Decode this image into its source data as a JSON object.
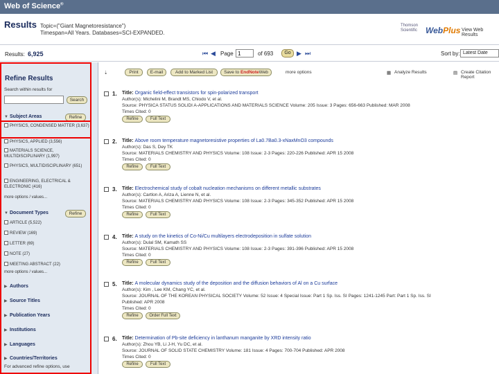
{
  "header": {
    "logo": "Web of Science",
    "logo_mark": "®"
  },
  "results": {
    "title": "Results",
    "topic": "Topic=(\"Giant Magnetoresistance\")",
    "timespan": "Timespan=All Years. Databases=SCI-EXPANDED.",
    "count_label": "Results:",
    "count": "6,925"
  },
  "brand": {
    "thomson": "Thomson",
    "scientific": "Scientific",
    "web": "Web",
    "plus": "Plus",
    "link": "View Web Results"
  },
  "pager": {
    "first": "⏮",
    "prev": "◀",
    "page_label": "Page",
    "page_value": "1",
    "of_label": "of 693",
    "go": "Go",
    "next": "▶",
    "last": "⏭"
  },
  "sort": {
    "label": "Sort by:",
    "value": "Latest Date"
  },
  "sidebar": {
    "title": "Refine Results",
    "search_within": "Search within results for",
    "search_button": "Search",
    "refine_button": "Refine",
    "subject": {
      "title": "Subject Areas",
      "items": [
        {
          "label": "PHYSICS, CONDENSED MATTER",
          "count": "(3,637)"
        },
        {
          "label": "PHYSICS, APPLIED",
          "count": "(3,556)"
        },
        {
          "label": "MATERIALS SCIENCE, MULTIDISCIPLINARY",
          "count": "(1,997)"
        },
        {
          "label": "PHYSICS, MULTIDISCIPLINARY",
          "count": "(651)"
        },
        {
          "label": "ENGINEERING, ELECTRICAL & ELECTRONIC",
          "count": "(416)"
        }
      ],
      "more": "more options / values..."
    },
    "doctypes": {
      "title": "Document Types",
      "items": [
        {
          "label": "ARTICLE",
          "count": "(5,522)"
        },
        {
          "label": "REVIEW",
          "count": "(169)"
        },
        {
          "label": "LETTER",
          "count": "(69)"
        },
        {
          "label": "NOTE",
          "count": "(27)"
        },
        {
          "label": "MEETING ABSTRACT",
          "count": "(22)"
        }
      ],
      "more": "more options / values..."
    },
    "collapsed": [
      "Authors",
      "Source Titles",
      "Publication Years",
      "Institutions",
      "Languages",
      "Countries/Territories"
    ],
    "footer": "For advanced refine options, use"
  },
  "toolbar": {
    "print": "Print",
    "email": "E-mail",
    "marked": "Add to Marked List",
    "save_prefix": "Save to",
    "endnote": "EndNote",
    "save_suffix": "Web",
    "more": "more options",
    "analyze": "Analyze Results",
    "citation": "Create Citation Report"
  },
  "buttons": {
    "refine": "Refine",
    "full_text": "Full Text",
    "order_full_text": "Order Full Text"
  },
  "records": [
    {
      "num": "1.",
      "title": "Organic field-effect transistors for spin-polarized transport",
      "authors": "Author(s): Michelini M, Brandt MS, Chiodo V, et al.",
      "source": "Source: PHYSICA STATUS SOLIDI A-APPLICATIONS AND MATERIALS SCIENCE   Volume: 205   Issue: 3   Pages: 656-663   Published: MAR 2008",
      "extra": "",
      "cited": "Times Cited: 0",
      "order": false
    },
    {
      "num": "2.",
      "title": "Above room temperature magnetoresistive properties of La0.7Ba0.3-xNaxMnO3 compounds",
      "authors": "Author(s): Das S, Dey TK",
      "source": "Source: MATERIALS CHEMISTRY AND PHYSICS   Volume: 108   Issue: 2-3   Pages: 220-226   Published: APR 15 2008",
      "extra": "",
      "cited": "Times Cited: 0",
      "order": false
    },
    {
      "num": "3.",
      "title": "Electrochemical study of cobalt nucleation mechanisms on different metallic substrates",
      "authors": "Author(s): Cartlon A, Ariza A, Lienne N, et al.",
      "source": "Source: MATERIALS CHEMISTRY AND PHYSICS   Volume: 108   Issue: 2-3   Pages: 345-352   Published: APR 15 2008",
      "extra": "",
      "cited": "Times Cited: 0",
      "order": false
    },
    {
      "num": "4.",
      "title": "A study on the kinetics of Co-Ni/Cu multilayers electrodeposition in sulfate solution",
      "authors": "Author(s): Dulal SM, Kamath SS",
      "source": "Source: MATERIALS CHEMISTRY AND PHYSICS   Volume: 108   Issue: 2-3   Pages: 391-396   Published: APR 15 2008",
      "extra": "",
      "cited": "Times Cited: 0",
      "order": false
    },
    {
      "num": "5.",
      "title": "A molecular dynamics study of the deposition and the diffusion behaviors of Al on a Cu surface",
      "authors": "Author(s): Kim , Lee KM, Chang YC, et al.",
      "source": "Source: JOURNAL OF THE KOREAN PHYSICAL SOCIETY   Volume: 52   Issue: 4   Special Issue: Part 1 Sp. Iss. SI   Pages: 1241-1245   Part: Part 1 Sp. Iss. SI",
      "extra": "Published: APR 2008",
      "cited": "Times Cited: 0",
      "order": true
    },
    {
      "num": "6.",
      "title": "Determination of Pb-site deficiency in lanthanum manganite by XRD intensity ratio",
      "authors": "Author(s): Zhou YB, Li J-H, Yu DC, et al.",
      "source": "Source: JOURNAL OF SOLID STATE CHEMISTRY   Volume: 181   Issue: 4   Pages: 700-704   Published: APR 2008",
      "extra": "",
      "cited": "Times Cited: 0",
      "order": false
    }
  ]
}
